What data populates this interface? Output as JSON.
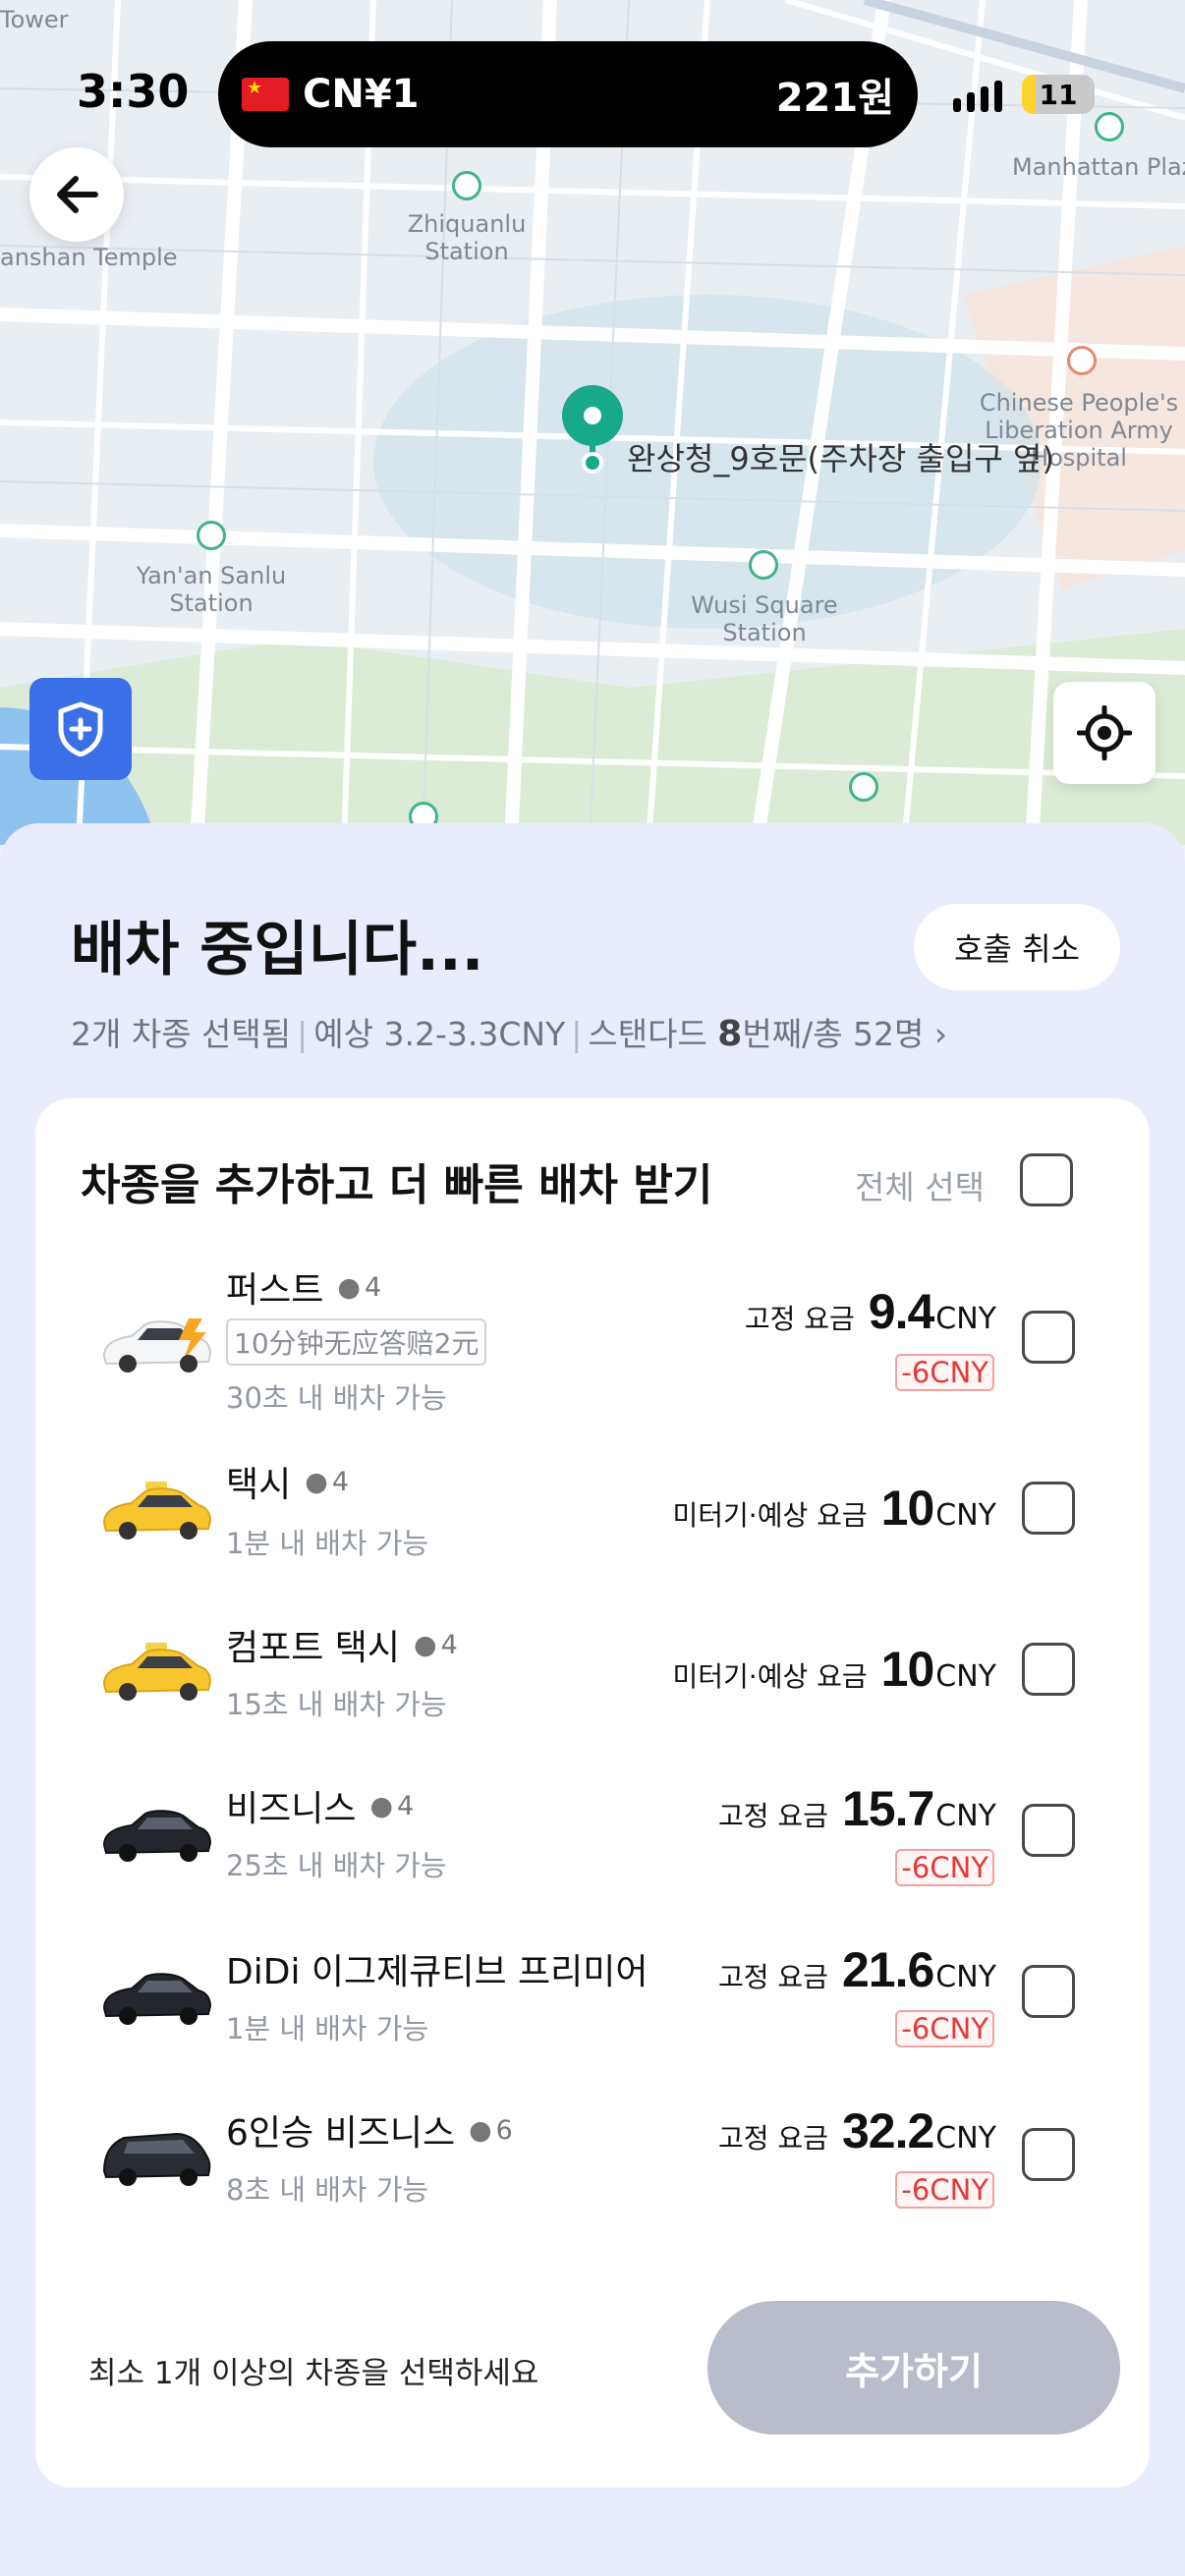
{
  "status_bar": {
    "time": "3:30",
    "currency_left": "CN¥1",
    "currency_right": "221원",
    "battery": "11"
  },
  "map": {
    "labels": [
      {
        "id": "tower",
        "text": "Tower"
      },
      {
        "id": "zhiquanlu",
        "text": "Zhiquanlu\nStation"
      },
      {
        "id": "manhattan",
        "text": "Manhattan Plaz"
      },
      {
        "id": "anshan",
        "text": "anshan Temple"
      },
      {
        "id": "chinese_pla",
        "text": "Chinese People's\nLiberation Army\nHospital"
      },
      {
        "id": "yanan",
        "text": "Yan'an Sanlu\nStation"
      },
      {
        "id": "wusi",
        "text": "Wusi Square\nStation"
      }
    ],
    "place_label": "완상청_9호문(주차장 출입구 옆)"
  },
  "sheet": {
    "title": "배차 중입니다...",
    "cancel_label": "호출 취소",
    "subtitle": {
      "selected": "2개 차종 선택됨",
      "estimate": "예상 3.2-3.3CNY",
      "queue_prefix": "스탠다드 ",
      "queue_rank": "8",
      "queue_suffix": "번째/총 52명",
      "chevron": "›"
    }
  },
  "card": {
    "title": "차종을 추가하고 더 빠른 배차 받기",
    "select_all_label": "전체 선택",
    "rows": [
      {
        "name": "퍼스트",
        "pax": "4",
        "promo": "10分钟无应答赔2元",
        "sub": "30초 내 배차 가능",
        "price_label": "고정 요금",
        "price": "9.4",
        "unit": "CNY",
        "discount": "-6CNY",
        "car": "white-ev-car-icon"
      },
      {
        "name": "택시",
        "pax": "4",
        "promo": "",
        "sub": "1분 내 배차 가능",
        "price_label": "미터기·예상 요금",
        "price": "10",
        "unit": "CNY",
        "discount": "",
        "car": "yellow-taxi-icon"
      },
      {
        "name": "컴포트 택시",
        "pax": "4",
        "promo": "",
        "sub": "15초 내 배차 가능",
        "price_label": "미터기·예상 요금",
        "price": "10",
        "unit": "CNY",
        "discount": "",
        "car": "yellow-taxi-icon"
      },
      {
        "name": "비즈니스",
        "pax": "4",
        "promo": "",
        "sub": "25초 내 배차 가능",
        "price_label": "고정 요금",
        "price": "15.7",
        "unit": "CNY",
        "discount": "-6CNY",
        "car": "black-sedan-icon"
      },
      {
        "name": "DiDi 이그제큐티브 프리미어",
        "pax": "",
        "promo": "",
        "sub": "1분 내 배차 가능",
        "price_label": "고정 요금",
        "price": "21.6",
        "unit": "CNY",
        "discount": "-6CNY",
        "car": "black-sedan-icon"
      },
      {
        "name": "6인승 비즈니스",
        "pax": "6",
        "promo": "",
        "sub": "8초 내 배차 가능",
        "price_label": "고정 요금",
        "price": "32.2",
        "unit": "CNY",
        "discount": "-6CNY",
        "car": "black-minivan-icon"
      }
    ],
    "hint": "최소 1개 이상의 차종을 선택하세요",
    "add_label": "추가하기"
  },
  "colors": {
    "accent_blue": "#3a6fe8",
    "pin_green": "#17a98a",
    "discount_red": "#e23a3a",
    "disabled_button": "#b9bdcb"
  }
}
